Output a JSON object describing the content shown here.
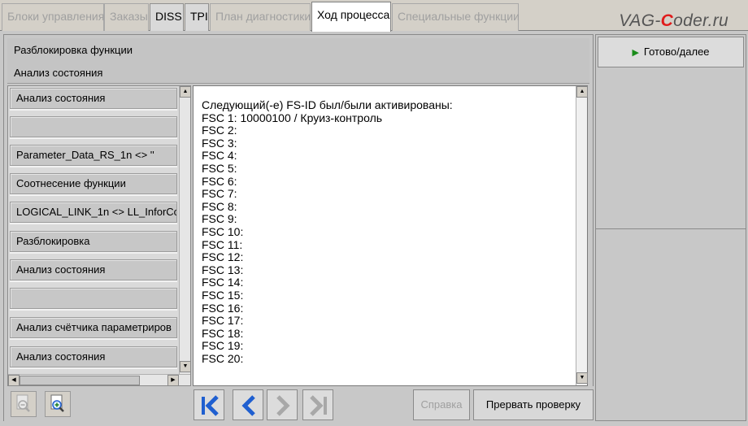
{
  "tabs": [
    {
      "label": "Блоки управления"
    },
    {
      "label": "Заказы"
    },
    {
      "label": "DISS"
    },
    {
      "label": "TPI"
    },
    {
      "label": "План диагностики"
    },
    {
      "label": "Ход процесса"
    },
    {
      "label": "Специальные функции"
    }
  ],
  "logo": {
    "part1": "VAG-",
    "part2": "C",
    "part3": "oder.ru"
  },
  "header": {
    "line1": "Разблокировка функции",
    "line2": "Анализ состояния"
  },
  "steps": [
    {
      "label": "Анализ состояния"
    },
    {
      "label": ""
    },
    {
      "label": "Parameter_Data_RS_1n <> ''"
    },
    {
      "label": "Соотнесение функции"
    },
    {
      "label": "LOGICAL_LINK_1n <> LL_InforCo"
    },
    {
      "label": "Разблокировка"
    },
    {
      "label": "Анализ состояния"
    },
    {
      "label": ""
    },
    {
      "label": "Анализ счётчика параметриров"
    },
    {
      "label": "Анализ состояния"
    }
  ],
  "text_pane": {
    "content": "Следующий(-е) FS-ID был/были активированы:\nFSC 1: 10000100 / Круиз-контроль\nFSC 2:\nFSC 3:\nFSC 4:\nFSC 5:\nFSC 6:\nFSC 7:\nFSC 8:\nFSC 9:\nFSC 10:\nFSC 11:\nFSC 12:\nFSC 13:\nFSC 14:\nFSC 15:\nFSC 16:\nFSC 17:\nFSC 18:\nFSC 19:\nFSC 20:"
  },
  "buttons": {
    "help": "Справка",
    "abort": "Прервать проверку",
    "done": "Готово/далее"
  },
  "icons": {
    "zoom_out": "zoom-out-icon",
    "zoom_in": "zoom-in-icon",
    "first": "skip-first-icon",
    "prev": "chevron-left-icon",
    "next": "chevron-right-icon",
    "last": "skip-last-icon",
    "play": "play-icon"
  },
  "colors": {
    "nav_active": "#1f5fd0",
    "nav_disabled": "#a8a8a8",
    "play": "#1a8c1a",
    "logo_accent": "#e01b1b"
  }
}
